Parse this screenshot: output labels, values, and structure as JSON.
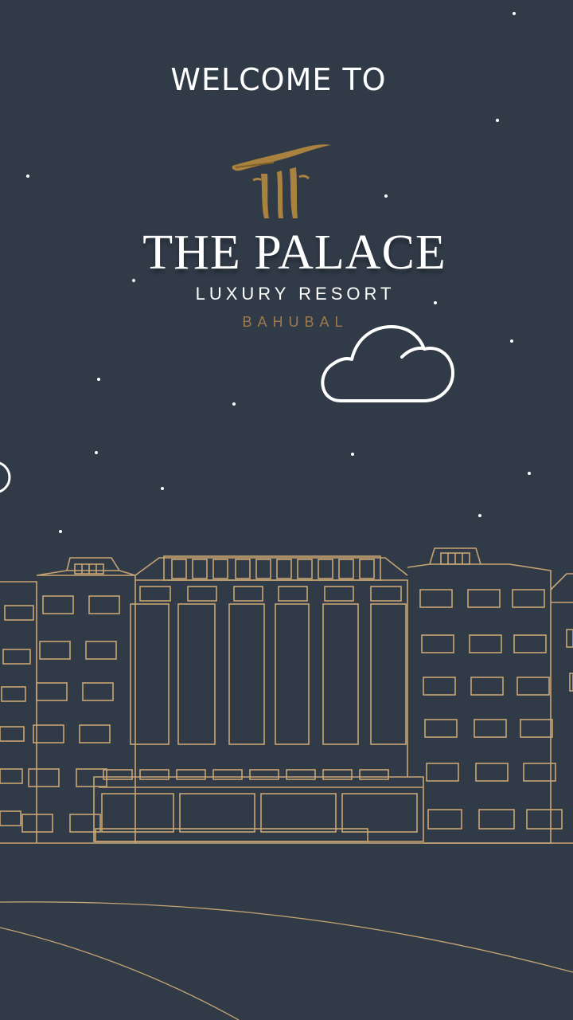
{
  "splash": {
    "welcome": "WELCOME TO",
    "brand_name": "THE PALACE",
    "brand_tagline": "LUXURY RESORT",
    "brand_location": "BAHUBAL"
  },
  "icons": {
    "logo": "palace-logo-icon",
    "cloud": "cloud-icon",
    "moon": "moon-icon"
  },
  "colors": {
    "background": "#313b48",
    "gold": "#c8a574",
    "accent_brown": "#9c7a4d",
    "text": "#ffffff"
  }
}
